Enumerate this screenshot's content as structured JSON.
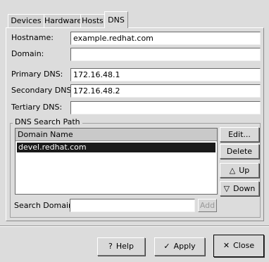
{
  "tabs": [
    {
      "label": "Devices"
    },
    {
      "label": "Hardware"
    },
    {
      "label": "Hosts"
    },
    {
      "label": "DNS",
      "active": true
    }
  ],
  "form": {
    "hostname": {
      "label": "Hostname:",
      "value": "example.redhat.com"
    },
    "domain": {
      "label": "Domain:",
      "value": ""
    },
    "primary_dns": {
      "label": "Primary DNS:",
      "value": "172.16.48.1"
    },
    "secondary_dns": {
      "label": "Secondary DNS:",
      "value": "172.16.48.2"
    },
    "tertiary_dns": {
      "label": "Tertiary DNS:",
      "value": ""
    }
  },
  "search_path": {
    "title": "DNS Search Path",
    "column_header": "Domain Name",
    "rows": [
      "devel.redhat.com"
    ],
    "selected_index": 0,
    "buttons": {
      "edit": "Edit...",
      "delete": "Delete",
      "up": "Up",
      "down": "Down"
    },
    "search_domain_label": "Search Domain:",
    "search_domain_value": "",
    "add_label": "Add"
  },
  "footer": {
    "help": "Help",
    "apply": "Apply",
    "close": "Close"
  },
  "icons": {
    "help": "help-icon",
    "apply": "checkmark-icon",
    "close": "x-icon",
    "up": "triangle-up-icon",
    "down": "triangle-down-icon"
  }
}
